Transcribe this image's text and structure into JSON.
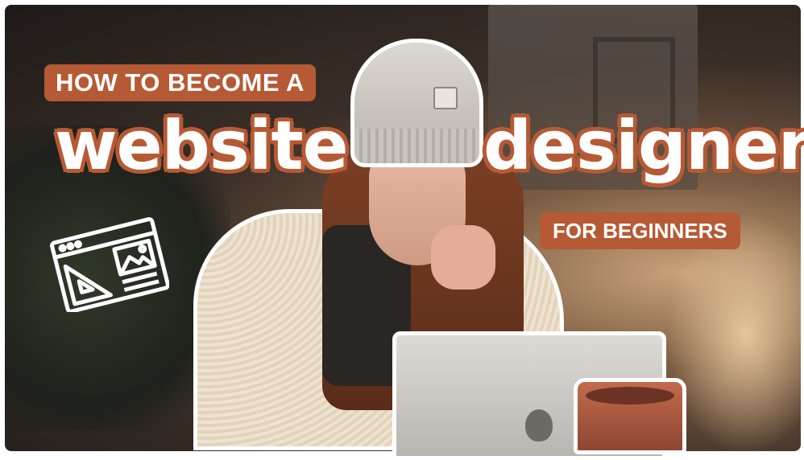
{
  "thumbnail": {
    "headline_top": "HOW TO BECOME A",
    "headline_word_1": "website",
    "headline_word_2": "designer",
    "headline_bottom": "FOR BEGINNERS"
  },
  "colors": {
    "accent": "#b65a35",
    "text": "#ffffff"
  },
  "icons": [
    "website-design-icon"
  ]
}
